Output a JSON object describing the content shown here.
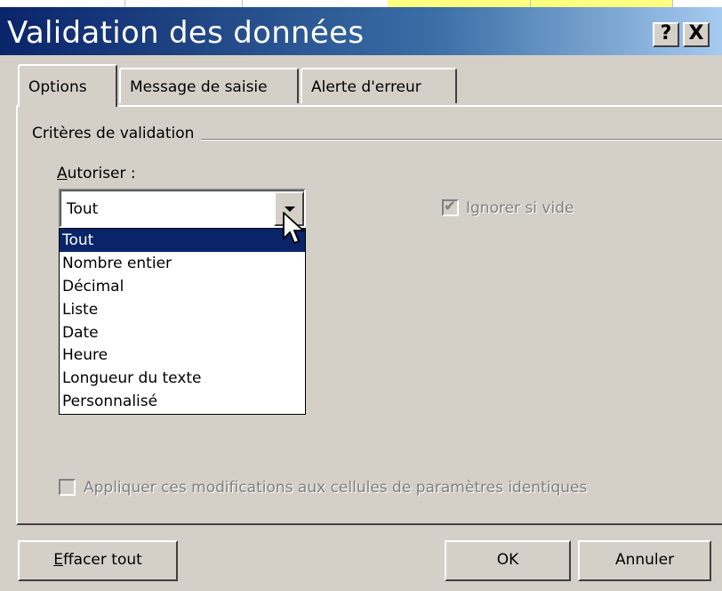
{
  "window": {
    "title": "Validation des données",
    "help_button": "?",
    "close_button": "X",
    "titlebar_colors": [
      "#0a246a",
      "#a6caf0"
    ]
  },
  "tabs": [
    {
      "label": "Options",
      "active": true
    },
    {
      "label": "Message de saisie",
      "active": false
    },
    {
      "label": "Alerte d'erreur",
      "active": false
    }
  ],
  "criteria": {
    "group_label": "Critères de validation",
    "allow_label_access_key": "A",
    "allow_label_rest": "utoriser :",
    "allow_value": "Tout",
    "options": [
      "Tout",
      "Nombre entier",
      "Décimal",
      "Liste",
      "Date",
      "Heure",
      "Longueur du texte",
      "Personnalisé"
    ],
    "selected_option": "Tout",
    "ignore_blank_label": "Ignorer si vide",
    "ignore_blank_checked": true,
    "ignore_blank_enabled": false,
    "apply_all_label": "Appliquer ces modifications aux cellules de paramètres identiques",
    "apply_all_checked": false,
    "apply_all_enabled": false
  },
  "buttons": {
    "clear_all_access_key": "E",
    "clear_all_rest": "ffacer tout",
    "ok": "OK",
    "cancel": "Annuler"
  }
}
